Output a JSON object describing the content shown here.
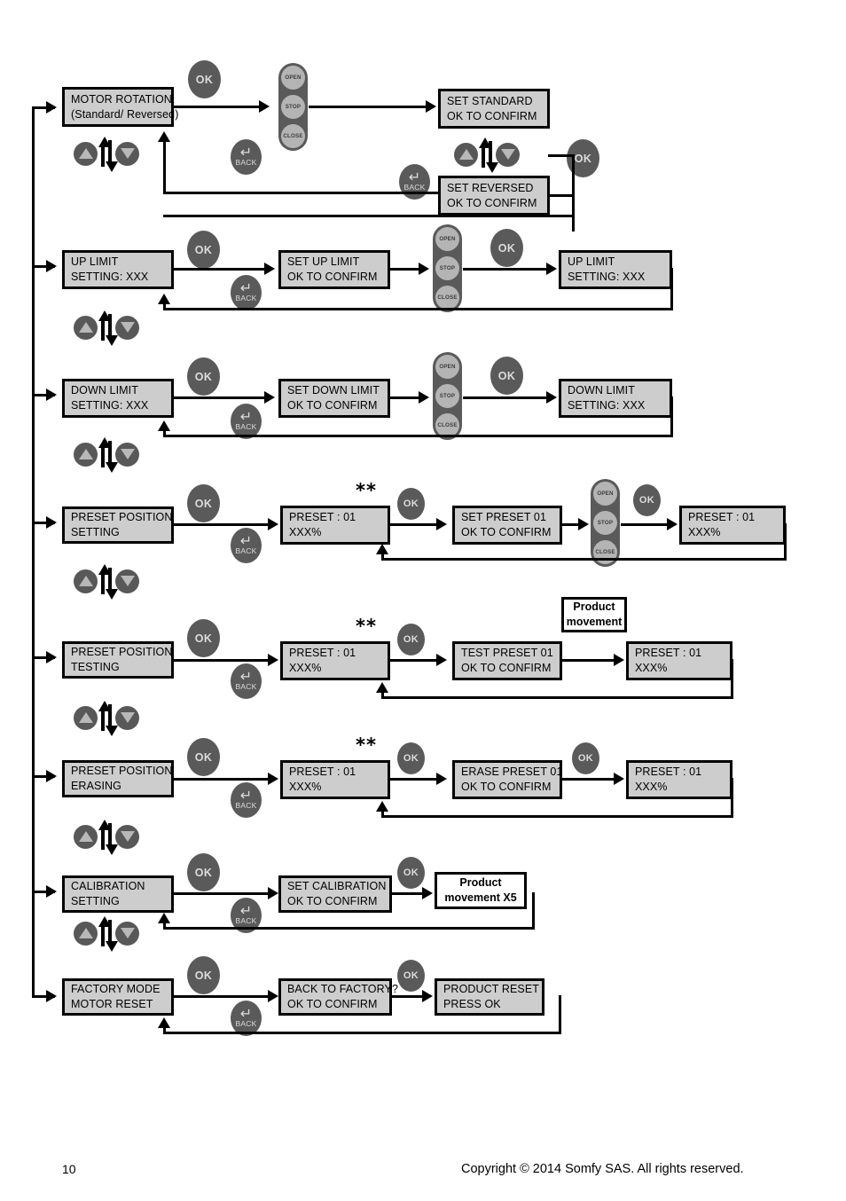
{
  "page": {
    "number": "10",
    "copyright": "Copyright © 2014 Somfy SAS. All rights reserved."
  },
  "buttons": {
    "ok": "OK",
    "back": "BACK",
    "back_glyph": "↵"
  },
  "remote": {
    "open": "OPEN",
    "stop": "STOP",
    "close": "CLOSE"
  },
  "markers": {
    "double_asterisk": "**"
  },
  "colors": {
    "lcd_fill": "#cdcdcd",
    "button_fill": "#5a5a5a",
    "remote_body": "#5a5a5a",
    "remote_key": "#b4b4b4",
    "line": "#000000",
    "page_background": "#ffffff"
  },
  "flows": [
    {
      "id": "motor-rotation",
      "menu": {
        "line1": "MOTOR ROTATION:",
        "line2": "(Standard/ Reversed)"
      },
      "screens": [
        {
          "id": "set-standard",
          "line1": "SET STANDARD",
          "line2": "OK TO CONFIRM"
        },
        {
          "id": "set-reversed",
          "line1": "SET REVERSED",
          "line2": "OK TO CONFIRM"
        }
      ]
    },
    {
      "id": "up-limit",
      "menu": {
        "line1": "UP LIMIT",
        "line2": "SETTING: XXX"
      },
      "screens": [
        {
          "id": "set-up-limit",
          "line1": "SET UP LIMIT",
          "line2": "OK TO CONFIRM"
        },
        {
          "id": "up-limit-result",
          "line1": "UP LIMIT",
          "line2": "SETTING: XXX"
        }
      ]
    },
    {
      "id": "down-limit",
      "menu": {
        "line1": "DOWN LIMIT",
        "line2": "SETTING: XXX"
      },
      "screens": [
        {
          "id": "set-down-limit",
          "line1": "SET DOWN LIMIT",
          "line2": "OK TO CONFIRM"
        },
        {
          "id": "down-limit-result",
          "line1": "DOWN LIMIT",
          "line2": "SETTING: XXX"
        }
      ]
    },
    {
      "id": "preset-position-setting",
      "menu": {
        "line1": "PRESET POSITION",
        "line2": "SETTING"
      },
      "screens": [
        {
          "id": "preset-select",
          "line1": "PRESET : 01",
          "line2": "XXX%"
        },
        {
          "id": "set-preset",
          "line1": "SET PRESET 01",
          "line2": "OK TO CONFIRM"
        },
        {
          "id": "preset-result",
          "line1": "PRESET : 01",
          "line2": "XXX%"
        }
      ]
    },
    {
      "id": "preset-position-testing",
      "menu": {
        "line1": "PRESET POSITION",
        "line2": "TESTING"
      },
      "screens": [
        {
          "id": "preset-select",
          "line1": "PRESET : 01",
          "line2": "XXX%"
        },
        {
          "id": "test-preset",
          "line1": "TEST PRESET 01",
          "line2": "OK TO CONFIRM"
        },
        {
          "id": "preset-result",
          "line1": "PRESET : 01",
          "line2": "XXX%"
        }
      ],
      "note": {
        "line1": "Product",
        "line2": "movement"
      }
    },
    {
      "id": "preset-position-erasing",
      "menu": {
        "line1": "PRESET POSITION",
        "line2": "ERASING"
      },
      "screens": [
        {
          "id": "preset-select",
          "line1": "PRESET : 01",
          "line2": "XXX%"
        },
        {
          "id": "erase-preset",
          "line1": "ERASE PRESET 01",
          "line2": "OK TO CONFIRM"
        },
        {
          "id": "preset-result",
          "line1": "PRESET : 01",
          "line2": "XXX%"
        }
      ]
    },
    {
      "id": "calibration",
      "menu": {
        "line1": "CALIBRATION",
        "line2": "SETTING"
      },
      "screens": [
        {
          "id": "set-calibration",
          "line1": "SET CALIBRATION",
          "line2": "OK TO CONFIRM"
        }
      ],
      "note": {
        "line1": "Product",
        "line2": "movement X5"
      }
    },
    {
      "id": "factory-mode",
      "menu": {
        "line1": "FACTORY MODE",
        "line2": "MOTOR RESET"
      },
      "screens": [
        {
          "id": "back-to-factory",
          "line1": "BACK TO FACTORY?",
          "line2": "OK TO CONFIRM"
        },
        {
          "id": "product-reset",
          "line1": "PRODUCT RESET",
          "line2": "PRESS OK"
        }
      ]
    }
  ]
}
